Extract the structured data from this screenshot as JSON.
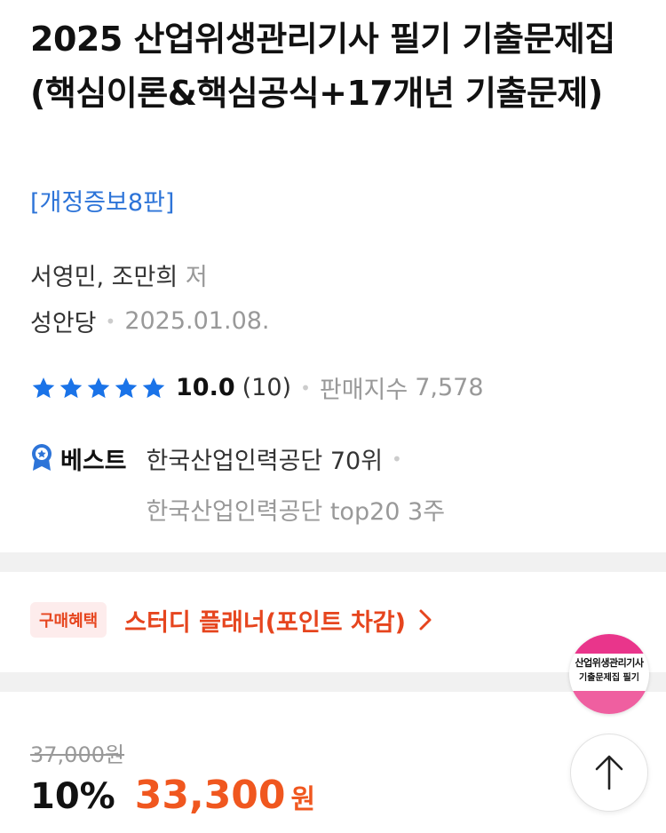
{
  "product": {
    "title": "2025 산업위생관리기사 필기 기출문제집 (핵심이론&핵심공식+17개년 기출문제)",
    "edition": "[개정증보8판]",
    "authors": "서영민, 조만희",
    "author_role": "저",
    "publisher": "성안당",
    "pub_date": "2025.01.08."
  },
  "rating": {
    "stars": 5,
    "value": "10.0",
    "count": "(10)",
    "sales_label": "판매지수",
    "sales_value": "7,578"
  },
  "best": {
    "label": "베스트",
    "rank1": "한국산업인력공단 70위",
    "rank2": "한국산업인력공단 top20 3주"
  },
  "benefit": {
    "badge": "구매혜택",
    "text": "스터디 플래너(포인트 차감)",
    "chevron_icon": "chevron-right-icon"
  },
  "price": {
    "original": "37,000원",
    "discount": "10%",
    "final": "33,300",
    "unit": "원"
  },
  "thumbnail": {
    "text1": "산업위생관리기사",
    "text2": "기출문제집 필기"
  },
  "scroll_top": {
    "icon": "arrow-up-icon"
  },
  "colors": {
    "accent_blue": "#2d74d8",
    "accent_orange": "#f0571f",
    "star_blue": "#1a73e8",
    "divider": "#f1f1f1"
  }
}
